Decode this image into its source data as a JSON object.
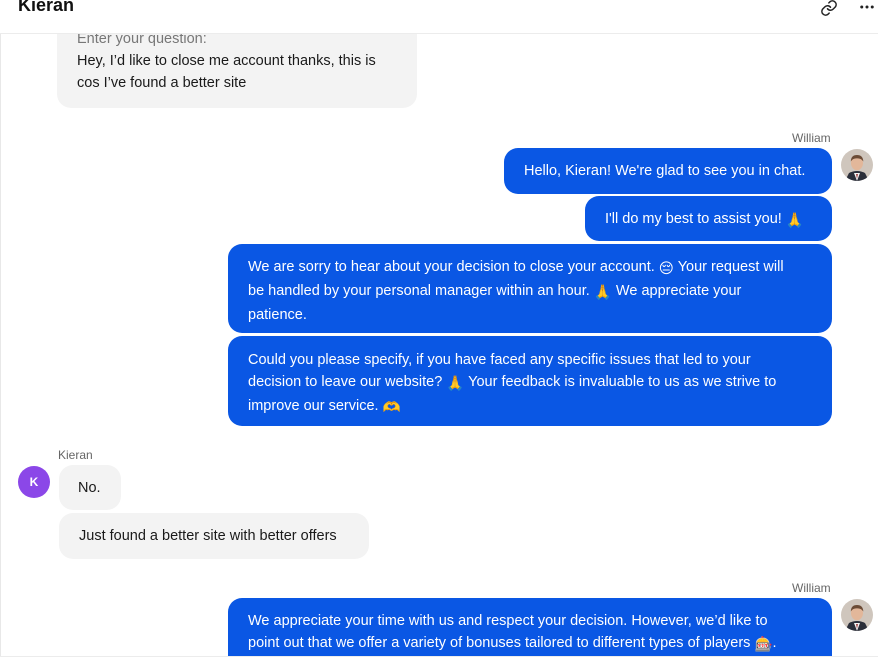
{
  "header": {
    "title": "Kieran",
    "link_icon": "link-icon",
    "more_icon": "more-horizontal-icon",
    "more_label": "•••"
  },
  "messages": {
    "m1": {
      "prompt": "Enter your question:",
      "line1": "Hey, I’d like to close me account thanks, this is",
      "line2": "cos I’ve found a better site"
    },
    "agent_name_1": "William",
    "m2": "Hello, Kieran! We're glad to see you in chat.",
    "m3": "I'll do my best to assist you!",
    "m4": {
      "line1a": "We are sorry to hear about your decision to close your account.",
      "line1b": "Your request will",
      "line2a": "be handled by your personal manager within an hour.",
      "line2b": "We appreciate your",
      "line3": "patience."
    },
    "m5": {
      "line1": "Could you please specify, if you have faced any specific issues that led to your",
      "line2a": "decision to leave our website?",
      "line2b": "Your feedback is invaluable to us as we strive to",
      "line3": "improve our service."
    },
    "customer_name": "Kieran",
    "customer_initial": "K",
    "m6": "No.",
    "m7": "Just found a better site with better offers",
    "agent_name_2": "William",
    "m8": {
      "line1": "We appreciate your time with us and respect your decision. However, we’d like to",
      "line2": "point out that we offer a variety of bonuses tailored to different types of players"
    }
  },
  "emojis": {
    "pray": "🙏",
    "sad": "😔",
    "heart_hands": "🫶",
    "slot": "🎰"
  },
  "colors": {
    "agent_bubble": "#0a57e4",
    "customer_bubble": "#f3f3f3",
    "customer_avatar": "#8b47e8"
  }
}
